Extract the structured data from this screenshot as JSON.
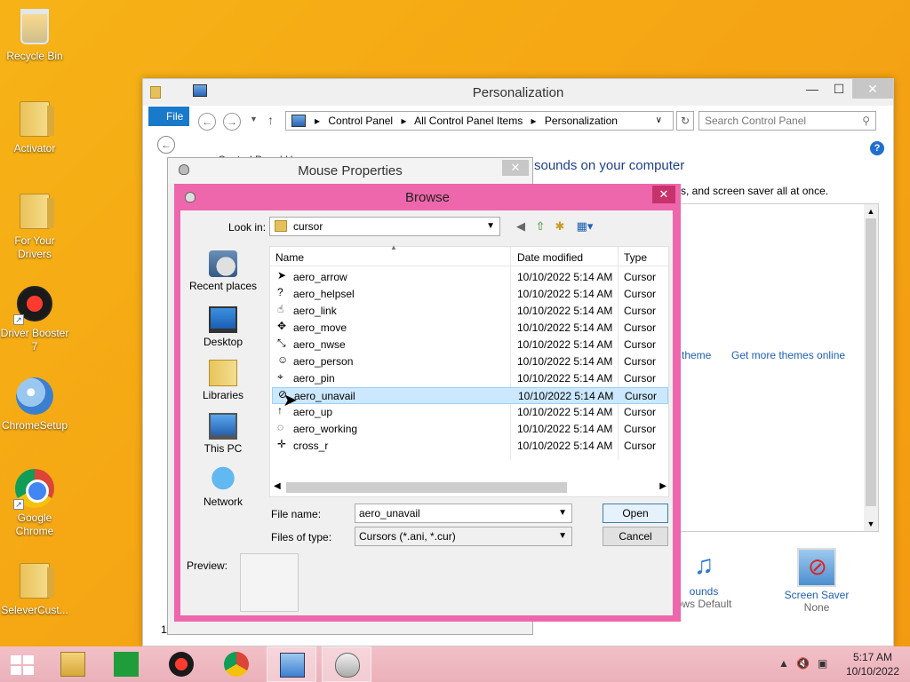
{
  "desktop": {
    "icons": [
      {
        "label": "Recycle Bin",
        "icon": "recycle-bin-icon"
      },
      {
        "label": "Activator",
        "icon": "folder-icon"
      },
      {
        "label": "For Your Drivers",
        "icon": "folder-icon"
      },
      {
        "label": "Driver Booster 7",
        "icon": "driver-booster-icon"
      },
      {
        "label": "ChromeSetup",
        "icon": "setup-disc-icon"
      },
      {
        "label": "Google Chrome",
        "icon": "chrome-icon"
      },
      {
        "label": "SeleverCust...",
        "icon": "folder-icon"
      }
    ]
  },
  "personalization": {
    "title": "Personalization",
    "file_tab": "File",
    "breadcrumb": [
      "Control Panel",
      "All Control Panel Items",
      "Personalization"
    ],
    "search_placeholder": "Search Control Panel",
    "heading": "sounds on your computer",
    "subtext": "s, and screen saver all at once.",
    "control_label": "Control Panel H",
    "links": [
      "theme",
      "Get more themes online"
    ],
    "bottom_items": [
      {
        "label": "ounds",
        "value": "ows Default"
      },
      {
        "label": "Screen Saver",
        "value": "None"
      }
    ],
    "status": "11 it"
  },
  "mouse_properties": {
    "title": "Mouse Properties"
  },
  "browse": {
    "title": "Browse",
    "look_in_label": "Look in:",
    "look_in_value": "cursor",
    "places": [
      "Recent places",
      "Desktop",
      "Libraries",
      "This PC",
      "Network"
    ],
    "columns": [
      "Name",
      "Date modified",
      "Type"
    ],
    "files": [
      {
        "name": "aero_arrow",
        "date": "10/10/2022 5:14 AM",
        "type": "Cursor"
      },
      {
        "name": "aero_helpsel",
        "date": "10/10/2022 5:14 AM",
        "type": "Cursor"
      },
      {
        "name": "aero_link",
        "date": "10/10/2022 5:14 AM",
        "type": "Cursor"
      },
      {
        "name": "aero_move",
        "date": "10/10/2022 5:14 AM",
        "type": "Cursor"
      },
      {
        "name": "aero_nwse",
        "date": "10/10/2022 5:14 AM",
        "type": "Cursor"
      },
      {
        "name": "aero_person",
        "date": "10/10/2022 5:14 AM",
        "type": "Cursor"
      },
      {
        "name": "aero_pin",
        "date": "10/10/2022 5:14 AM",
        "type": "Cursor"
      },
      {
        "name": "aero_unavail",
        "date": "10/10/2022 5:14 AM",
        "type": "Cursor",
        "selected": true
      },
      {
        "name": "aero_up",
        "date": "10/10/2022 5:14 AM",
        "type": "Cursor"
      },
      {
        "name": "aero_working",
        "date": "10/10/2022 5:14 AM",
        "type": "Cursor"
      },
      {
        "name": "cross_r",
        "date": "10/10/2022 5:14 AM",
        "type": "Cursor"
      }
    ],
    "file_name_label": "File name:",
    "file_name_value": "aero_unavail",
    "file_type_label": "Files of type:",
    "file_type_value": "Cursors (*.ani, *.cur)",
    "open_label": "Open",
    "cancel_label": "Cancel",
    "preview_label": "Preview:"
  },
  "taskbar": {
    "time": "5:17 AM",
    "date": "10/10/2022"
  },
  "colors": {
    "browse_frame": "#ee66ab",
    "selection": "#cce8ff",
    "link": "#1e5fb4",
    "desktop": "#f5a614",
    "taskbar": "#eab1ba"
  }
}
